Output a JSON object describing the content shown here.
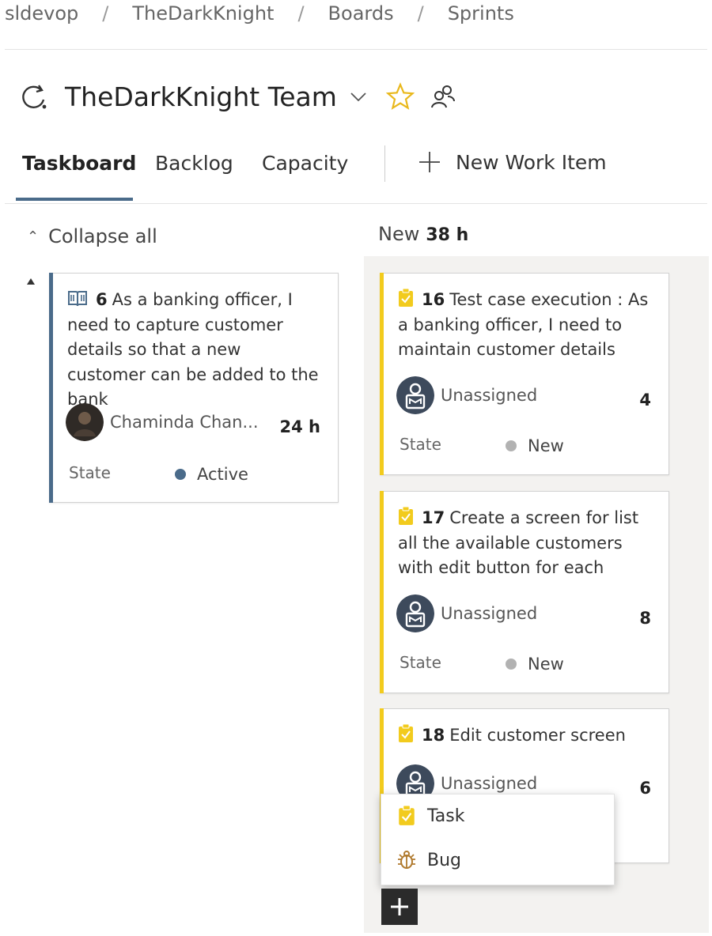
{
  "breadcrumb": [
    "sldevop",
    "TheDarkKnight",
    "Boards",
    "Sprints"
  ],
  "breadcrumb_separator": "/",
  "team": {
    "title": "TheDarkKnight Team"
  },
  "tabs": [
    "Taskboard",
    "Backlog",
    "Capacity"
  ],
  "new_item_label": "New Work Item",
  "collapse_label": "Collapse all",
  "column": {
    "name": "New",
    "hours": "38 h"
  },
  "story_card": {
    "id": "6",
    "title": "As a banking officer, I need to capture customer details so that a new customer can be added to the bank",
    "assignee": "Chaminda Chan...",
    "hours": "24 h",
    "state_label": "State",
    "state": "Active",
    "state_color": "#4a6b8a"
  },
  "task_cards": [
    {
      "id": "16",
      "title": "Test case execution : As a banking officer, I need to maintain customer details",
      "assignee": "Unassigned",
      "remaining": "4",
      "state_label": "State",
      "state": "New"
    },
    {
      "id": "17",
      "title": "Create a screen for list all the available customers with edit button for each",
      "assignee": "Unassigned",
      "remaining": "8",
      "state_label": "State",
      "state": "New"
    },
    {
      "id": "18",
      "title": "Edit customer screen",
      "assignee": "Unassigned",
      "remaining": "6"
    }
  ],
  "add_menu": [
    "Task",
    "Bug"
  ],
  "colors": {
    "task": "#f2cb1d",
    "story": "#4a6b8a",
    "new_state": "#b2b2b2",
    "accent": "#4a6b8a"
  },
  "icons": [
    "sprint-icon",
    "chevron-down-icon",
    "favorite-star-icon",
    "team-members-icon",
    "plus-icon",
    "collapse-icon",
    "book-icon",
    "task-clipboard-icon",
    "bug-icon",
    "user-avatar-icon"
  ]
}
